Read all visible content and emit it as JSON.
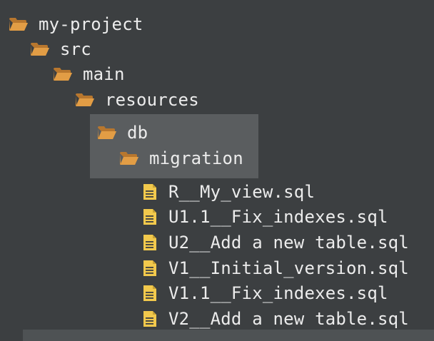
{
  "tree": {
    "root": {
      "label": "my-project",
      "icon": "folder-open-icon"
    },
    "src": {
      "label": "src",
      "icon": "folder-open-icon"
    },
    "main": {
      "label": "main",
      "icon": "folder-open-icon"
    },
    "resources": {
      "label": "resources",
      "icon": "folder-open-icon"
    },
    "db": {
      "label": "db",
      "icon": "folder-open-icon"
    },
    "migration": {
      "label": "migration",
      "icon": "folder-open-icon"
    },
    "files": [
      {
        "label": "R__My_view.sql",
        "icon": "sql-file-icon"
      },
      {
        "label": "U1.1__Fix_indexes.sql",
        "icon": "sql-file-icon"
      },
      {
        "label": "U2__Add a new table.sql",
        "icon": "sql-file-icon"
      },
      {
        "label": "V1__Initial_version.sql",
        "icon": "sql-file-icon"
      },
      {
        "label": "V1.1__Fix_indexes.sql",
        "icon": "sql-file-icon"
      },
      {
        "label": "V2__Add a new table.sql",
        "icon": "sql-file-icon"
      }
    ]
  },
  "colors": {
    "background": "#3c3f41",
    "selection": "#5a5d5f",
    "folder": "#d8913a",
    "file": "#f2c94c",
    "text": "#ececec"
  }
}
